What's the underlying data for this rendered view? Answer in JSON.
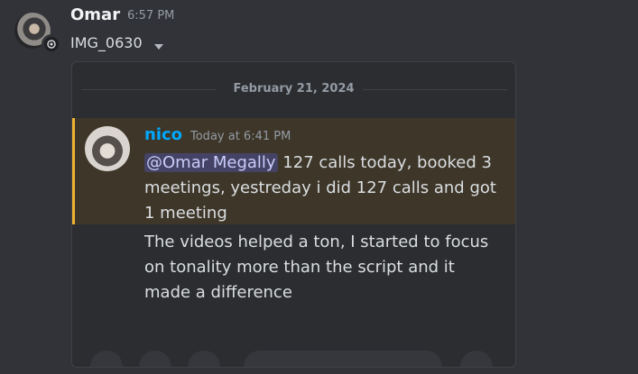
{
  "message": {
    "author": "Omar",
    "time": "6:57 PM",
    "attachment_name": "IMG_0630",
    "icons": {
      "avatar": "user-avatar",
      "badge": "app-badge-icon",
      "chevron": "chevron-down-icon"
    }
  },
  "embed": {
    "date": "February 21, 2024",
    "quoted": {
      "author": "nico",
      "time": "Today at 6:41 PM",
      "mention": "@Omar Megally",
      "text_after_mention": " 127 calls today, booked 3 meetings, yestreday i did 127 calls and got 1 meeting",
      "followup": "The videos helped a ton, I started to focus on tonality more than the script and it made a difference"
    }
  },
  "colors": {
    "background": "#313338",
    "embed": "#2b2d31",
    "highlight": "#3d3629",
    "highlight_border": "#f0b232",
    "author_link": "#00a8fc",
    "mention_bg": "rgba(88,101,242,0.3)"
  }
}
